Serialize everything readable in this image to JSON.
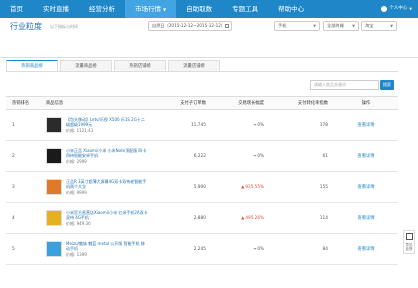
{
  "nav": {
    "items": [
      {
        "label": "首页",
        "active": false
      },
      {
        "label": "实时直播",
        "active": false
      },
      {
        "label": "经营分析",
        "active": false
      },
      {
        "label": "市场行情",
        "active": true
      },
      {
        "label": "自助取数",
        "active": false
      },
      {
        "label": "专题工具",
        "active": false
      },
      {
        "label": "帮助中心",
        "active": false
      }
    ],
    "user": "个人中心"
  },
  "header": {
    "title": "行业粒度",
    "subtitle": "以下指标与时间",
    "date_range": "自然日（2015-12-12~2015-12-12）",
    "device_select": "手机",
    "cat1_select": "全部终端",
    "cat2_select": "淘宝"
  },
  "tabs": [
    "热销商品榜",
    "流量商品榜",
    "热销店铺榜",
    "流量店铺榜"
  ],
  "search": {
    "placeholder": "请输入商品关键词",
    "button": "搜索"
  },
  "table": {
    "headers": [
      "热销排名",
      "商品信息",
      "支付子订单数",
      "交易增长幅度",
      "支付转化率指数",
      "操作"
    ],
    "rows": [
      {
        "rank": "1",
        "name": "【包头移动】Letv/乐视 X500 乐1S 2G十二级超级1999元",
        "price": "价格: 1121.43",
        "sold": "11,745",
        "trend": "0%",
        "trend_dir": "flat",
        "rate": "178",
        "op": "查看详情",
        "thumb_color": "#2b2b2b"
      },
      {
        "rank": "2",
        "name": "小米正品 Xiaomi/小米 小米Note顶配版 四卡四待智能安卓手机",
        "price": "价格: 2999",
        "sold": "6,222",
        "trend": "0%",
        "trend_dir": "flat",
        "rate": "61",
        "op": "查看详情",
        "thumb_color": "#1a1a1a"
      },
      {
        "rank": "3",
        "name": "正品R 3英寸超薄大屏幕4G双卡双待老智能手机两个大全",
        "price": "价格: 9999",
        "sold": "5,900",
        "trend": "935.55%",
        "trend_dir": "up",
        "rate": "155",
        "op": "查看详情",
        "thumb_color": "#e07a2a"
      },
      {
        "rank": "4",
        "name": "小米官方直营店Xiaomi/小米 红米手机2A双卡双待 4G手机",
        "price": "价格: 949.36",
        "sold": "2,880",
        "trend": "495.26%",
        "trend_dir": "up",
        "rate": "114",
        "op": "查看详情",
        "thumb_color": "#e6b020"
      },
      {
        "rank": "5",
        "name": "Meizu/魅族 魅蓝 metal 公开版 智能手机 移动手机",
        "price": "价格: 1399",
        "sold": "2,245",
        "trend": "0%",
        "trend_dir": "flat",
        "rate": "84",
        "op": "查看详情",
        "thumb_color": "#3aa0e0"
      }
    ]
  },
  "side": {
    "label": "意见反馈"
  }
}
